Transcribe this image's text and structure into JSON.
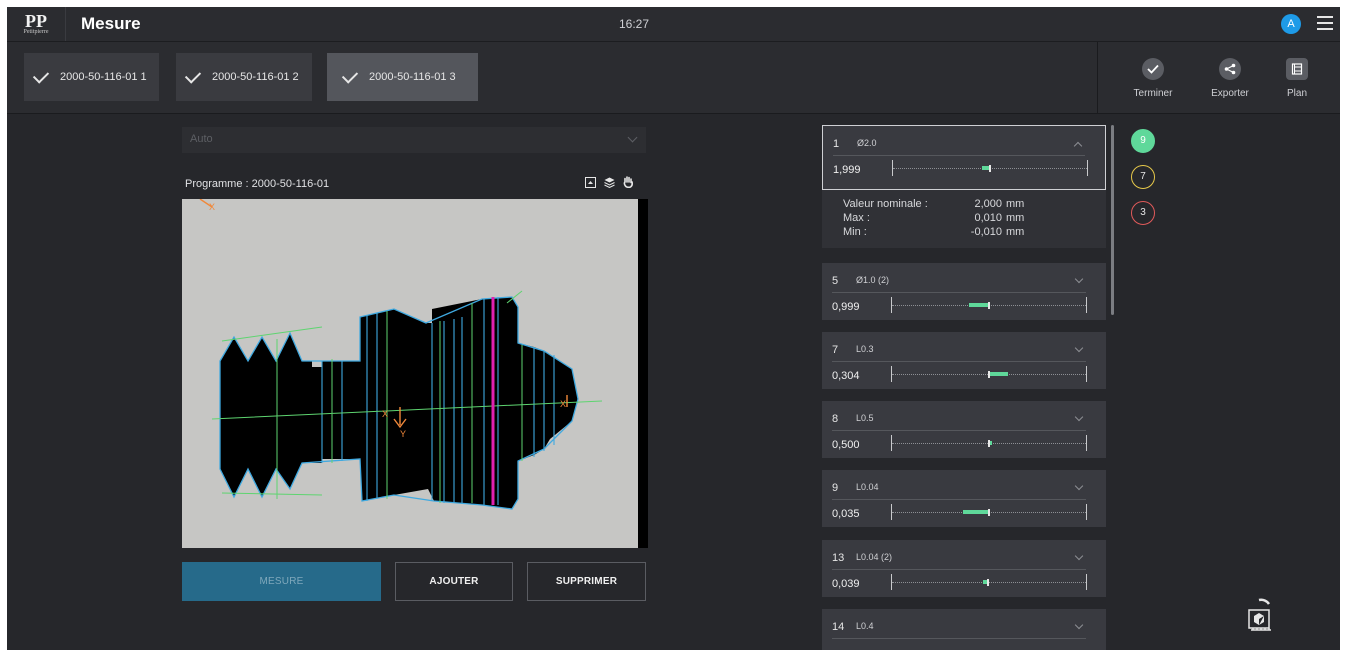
{
  "header": {
    "logo_text": "PP",
    "brand": "Petitpierre",
    "title": "Mesure",
    "time": "16:27",
    "avatar_initial": "A",
    "menu_icon": "hamburger-icon"
  },
  "tabs": [
    {
      "label": "2000-50-116-01 1",
      "checked": true
    },
    {
      "label": "2000-50-116-01 2",
      "checked": true
    },
    {
      "label": "2000-50-116-01 3",
      "checked": true,
      "active": true
    }
  ],
  "actions": [
    {
      "label": "Terminer",
      "icon": "check-icon"
    },
    {
      "label": "Exporter",
      "icon": "share-icon"
    },
    {
      "label": "Plan",
      "icon": "blueprint-icon"
    }
  ],
  "mode_select": {
    "value": "Auto"
  },
  "program": {
    "label": "Programme : 2000-50-116-01"
  },
  "viewer_tools": [
    "crop-icon",
    "layers-icon",
    "hand-icon"
  ],
  "buttons": {
    "measure": "MESURE",
    "add": "AJOUTER",
    "delete": "SUPPRIMER"
  },
  "measurements": [
    {
      "num": "1",
      "name": "Ø2.0",
      "value": "1,999",
      "expanded": true,
      "deviation_ratio": -0.05
    },
    {
      "num": "5",
      "name": "Ø1.0 (2)",
      "value": "0,999",
      "expanded": false,
      "deviation_ratio": -0.2
    },
    {
      "num": "7",
      "name": "L0.3",
      "value": "0,304",
      "expanded": false,
      "deviation_ratio": 0.2
    },
    {
      "num": "8",
      "name": "L0.5",
      "value": "0,500",
      "expanded": false,
      "deviation_ratio": 0.0
    },
    {
      "num": "9",
      "name": "L0.04",
      "value": "0,035",
      "expanded": false,
      "deviation_ratio": -0.25
    },
    {
      "num": "13",
      "name": "L0.04 (2)",
      "value": "0,039",
      "expanded": false,
      "deviation_ratio": -0.05
    },
    {
      "num": "14",
      "name": "L0.4",
      "value": "",
      "expanded": false,
      "deviation_ratio": 0
    }
  ],
  "details": {
    "nominal_label": "Valeur nominale :",
    "nominal_value": "2,000",
    "max_label": "Max :",
    "max_value": "0,010",
    "min_label": "Min :",
    "min_value": "-0,010",
    "unit": "mm"
  },
  "counters": {
    "ok": "9",
    "warning": "7",
    "error": "3"
  },
  "colors": {
    "ok": "#5fd89a",
    "warning": "#e6c84a",
    "error": "#e05a5a",
    "primary": "#266a8a"
  }
}
